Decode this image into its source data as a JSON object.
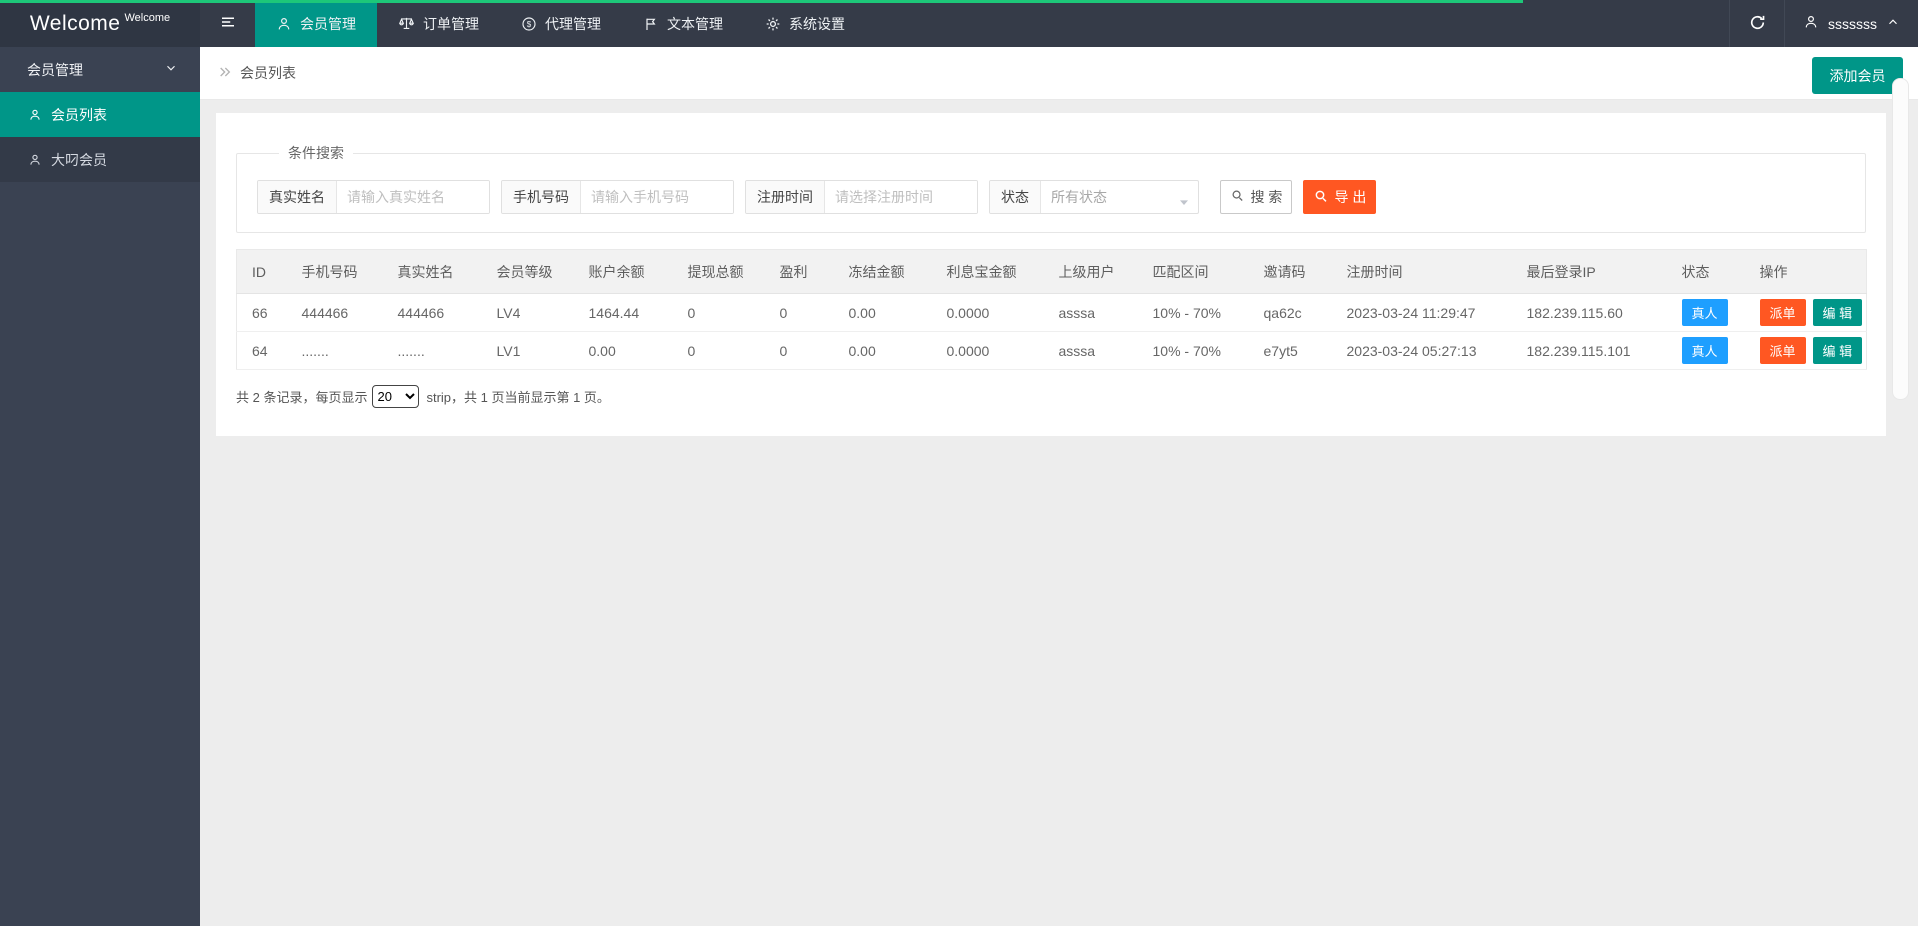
{
  "colors": {
    "teal": "#009688",
    "orange": "#ff5722",
    "blue": "#1e9fff",
    "progress_green": "#1dc779",
    "header_dark": "#353b48"
  },
  "header": {
    "logo": "Welcome",
    "logo_sup": "Welcome",
    "nav": [
      {
        "label": "会员管理",
        "icon": "person-icon",
        "active": true
      },
      {
        "label": "订单管理",
        "icon": "scales-icon",
        "active": false
      },
      {
        "label": "代理管理",
        "icon": "dollar-icon",
        "active": false
      },
      {
        "label": "文本管理",
        "icon": "flag-icon",
        "active": false
      },
      {
        "label": "系统设置",
        "icon": "gear-icon",
        "active": false
      }
    ],
    "refresh_icon": "refresh-icon",
    "user": {
      "name": "sssssss",
      "icon": "user-icon",
      "caret": "chevron-up-icon"
    }
  },
  "sidebar": {
    "group": {
      "label": "会员管理",
      "caret": "chevron-down-icon"
    },
    "items": [
      {
        "label": "会员列表",
        "icon": "person-icon",
        "active": true
      },
      {
        "label": "大叼会员",
        "icon": "person-icon",
        "active": false
      }
    ]
  },
  "breadcrumb": {
    "title": "会员列表",
    "icon": "double-chevron-right-icon"
  },
  "actions": {
    "add_member": "添加会员"
  },
  "search": {
    "legend": "条件搜索",
    "fields": [
      {
        "label": "真实姓名",
        "placeholder": "请输入真实姓名"
      },
      {
        "label": "手机号码",
        "placeholder": "请输入手机号码"
      },
      {
        "label": "注册时间",
        "placeholder": "请选择注册时间"
      },
      {
        "label": "状态",
        "value": "所有状态"
      }
    ],
    "search_label": "搜 索",
    "export_label": "导 出"
  },
  "table": {
    "columns": [
      "ID",
      "手机号码",
      "真实姓名",
      "会员等级",
      "账户余额",
      "提现总额",
      "盈利",
      "冻结金额",
      "利息宝金额",
      "上级用户",
      "匹配区间",
      "邀请码",
      "注册时间",
      "最后登录IP",
      "状态",
      "操作"
    ],
    "rows": [
      {
        "id": "66",
        "phone": "444466",
        "real_name": "444466",
        "level": "LV4",
        "balance": "1464.44",
        "withdraw_total": "0",
        "profit": "0",
        "frozen": "0.00",
        "lixibao": "0.0000",
        "parent": "asssa",
        "match_range": "10% - 70%",
        "invite_code": "qa62c",
        "register_time": "2023-03-24 11:29:47",
        "last_login_ip": "182.239.115.60",
        "status": "真人",
        "ops": [
          "派单",
          "编 辑"
        ]
      },
      {
        "id": "64",
        "phone": ".......",
        "real_name": ".......",
        "level": "LV1",
        "balance": "0.00",
        "withdraw_total": "0",
        "profit": "0",
        "frozen": "0.00",
        "lixibao": "0.0000",
        "parent": "asssa",
        "match_range": "10% - 70%",
        "invite_code": "e7yt5",
        "register_time": "2023-03-24 05:27:13",
        "last_login_ip": "182.239.115.101",
        "status": "真人",
        "ops": [
          "派单",
          "编 辑"
        ]
      }
    ]
  },
  "pagination": {
    "prefix": "共 2 条记录，每页显示",
    "page_size": "20",
    "suffix": "strip，共 1 页当前显示第 1 页。"
  }
}
